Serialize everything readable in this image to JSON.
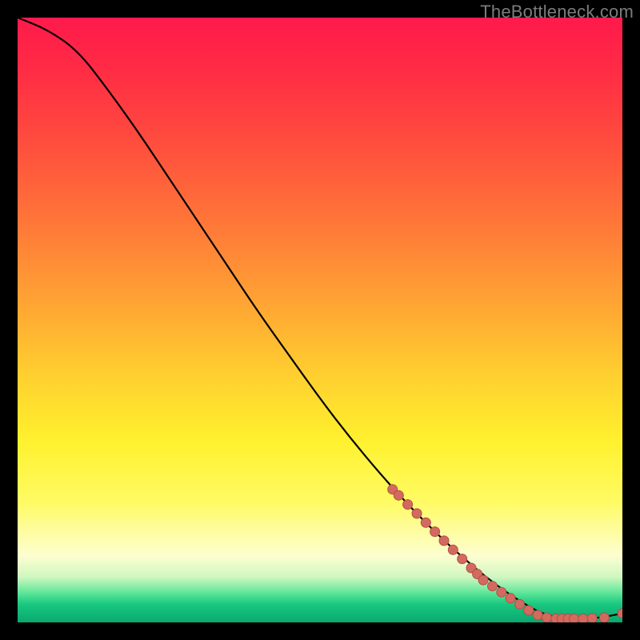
{
  "watermark": "TheBottleneck.com",
  "colors": {
    "curve": "#000000",
    "marker_fill": "#d46a5f",
    "marker_stroke": "#b24f47",
    "background_black": "#000000"
  },
  "chart_data": {
    "type": "line",
    "title": "",
    "xlabel": "",
    "ylabel": "",
    "xlim": [
      0,
      100
    ],
    "ylim": [
      0,
      100
    ],
    "grid": false,
    "legend": null,
    "series": [
      {
        "name": "curve",
        "x": [
          0,
          5,
          10,
          15,
          20,
          25,
          30,
          35,
          40,
          45,
          50,
          55,
          60,
          65,
          70,
          75,
          80,
          85,
          88,
          92,
          96,
          100
        ],
        "y": [
          100,
          98,
          94.5,
          88,
          81,
          73.5,
          66,
          58.5,
          51,
          44,
          37,
          30.5,
          24.5,
          19,
          14,
          9.5,
          5.5,
          2.3,
          1.0,
          0.6,
          0.7,
          1.5
        ]
      }
    ],
    "markers": [
      {
        "x": 62,
        "y": 22
      },
      {
        "x": 63,
        "y": 21
      },
      {
        "x": 64.5,
        "y": 19.5
      },
      {
        "x": 66,
        "y": 18
      },
      {
        "x": 67.5,
        "y": 16.5
      },
      {
        "x": 69,
        "y": 15
      },
      {
        "x": 70.5,
        "y": 13.5
      },
      {
        "x": 72,
        "y": 12
      },
      {
        "x": 73.5,
        "y": 10.5
      },
      {
        "x": 75,
        "y": 9
      },
      {
        "x": 76,
        "y": 8
      },
      {
        "x": 77,
        "y": 7
      },
      {
        "x": 78.5,
        "y": 6
      },
      {
        "x": 80,
        "y": 5
      },
      {
        "x": 81.5,
        "y": 4
      },
      {
        "x": 83,
        "y": 3
      },
      {
        "x": 84.5,
        "y": 2
      },
      {
        "x": 86,
        "y": 1.2
      },
      {
        "x": 87.5,
        "y": 0.8
      },
      {
        "x": 89,
        "y": 0.6
      },
      {
        "x": 90,
        "y": 0.6
      },
      {
        "x": 91,
        "y": 0.6
      },
      {
        "x": 92,
        "y": 0.6
      },
      {
        "x": 93.5,
        "y": 0.6
      },
      {
        "x": 95,
        "y": 0.7
      },
      {
        "x": 97,
        "y": 0.8
      },
      {
        "x": 100,
        "y": 1.5
      }
    ]
  }
}
